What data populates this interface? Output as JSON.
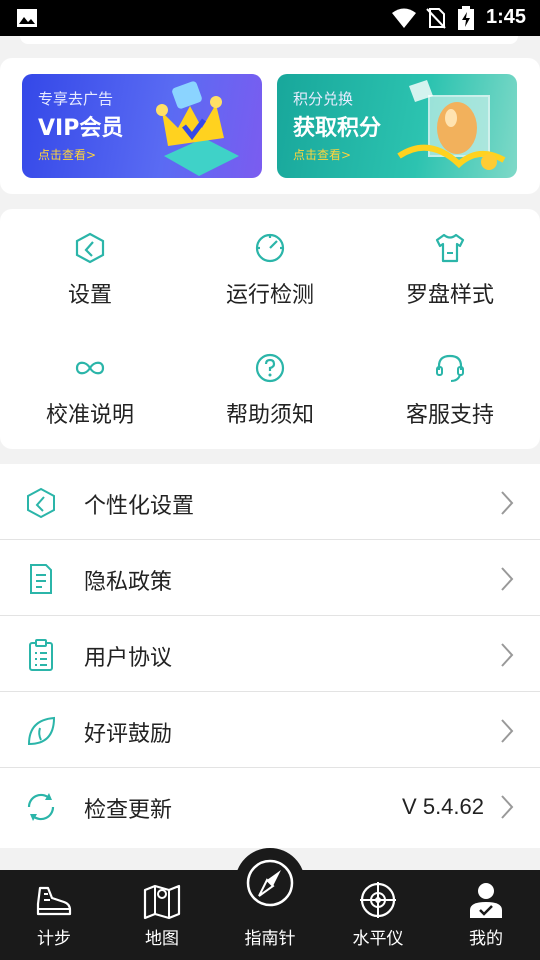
{
  "status_bar": {
    "time": "1:45"
  },
  "banners": [
    {
      "sub": "专享去广告",
      "main": "VIP会员",
      "cta": "点击查看>"
    },
    {
      "sub": "积分兑换",
      "main": "获取积分",
      "cta": "点击查看>"
    }
  ],
  "grid": [
    {
      "label": "设置",
      "icon": "hexagon-settings-icon"
    },
    {
      "label": "运行检测",
      "icon": "gauge-icon"
    },
    {
      "label": "罗盘样式",
      "icon": "tshirt-icon"
    },
    {
      "label": "校准说明",
      "icon": "infinity-icon"
    },
    {
      "label": "帮助须知",
      "icon": "question-circle-icon"
    },
    {
      "label": "客服支持",
      "icon": "headset-icon"
    }
  ],
  "list": [
    {
      "label": "个性化设置",
      "value": ""
    },
    {
      "label": "隐私政策",
      "value": ""
    },
    {
      "label": "用户协议",
      "value": ""
    },
    {
      "label": "好评鼓励",
      "value": ""
    },
    {
      "label": "检查更新",
      "value": "V 5.4.62"
    }
  ],
  "bottom_nav": [
    {
      "label": "计步"
    },
    {
      "label": "地图"
    },
    {
      "label": "指南针"
    },
    {
      "label": "水平仪"
    },
    {
      "label": "我的"
    }
  ],
  "colors": {
    "accent": "#2bb5a9",
    "nav_bg": "#1a1a1a"
  }
}
